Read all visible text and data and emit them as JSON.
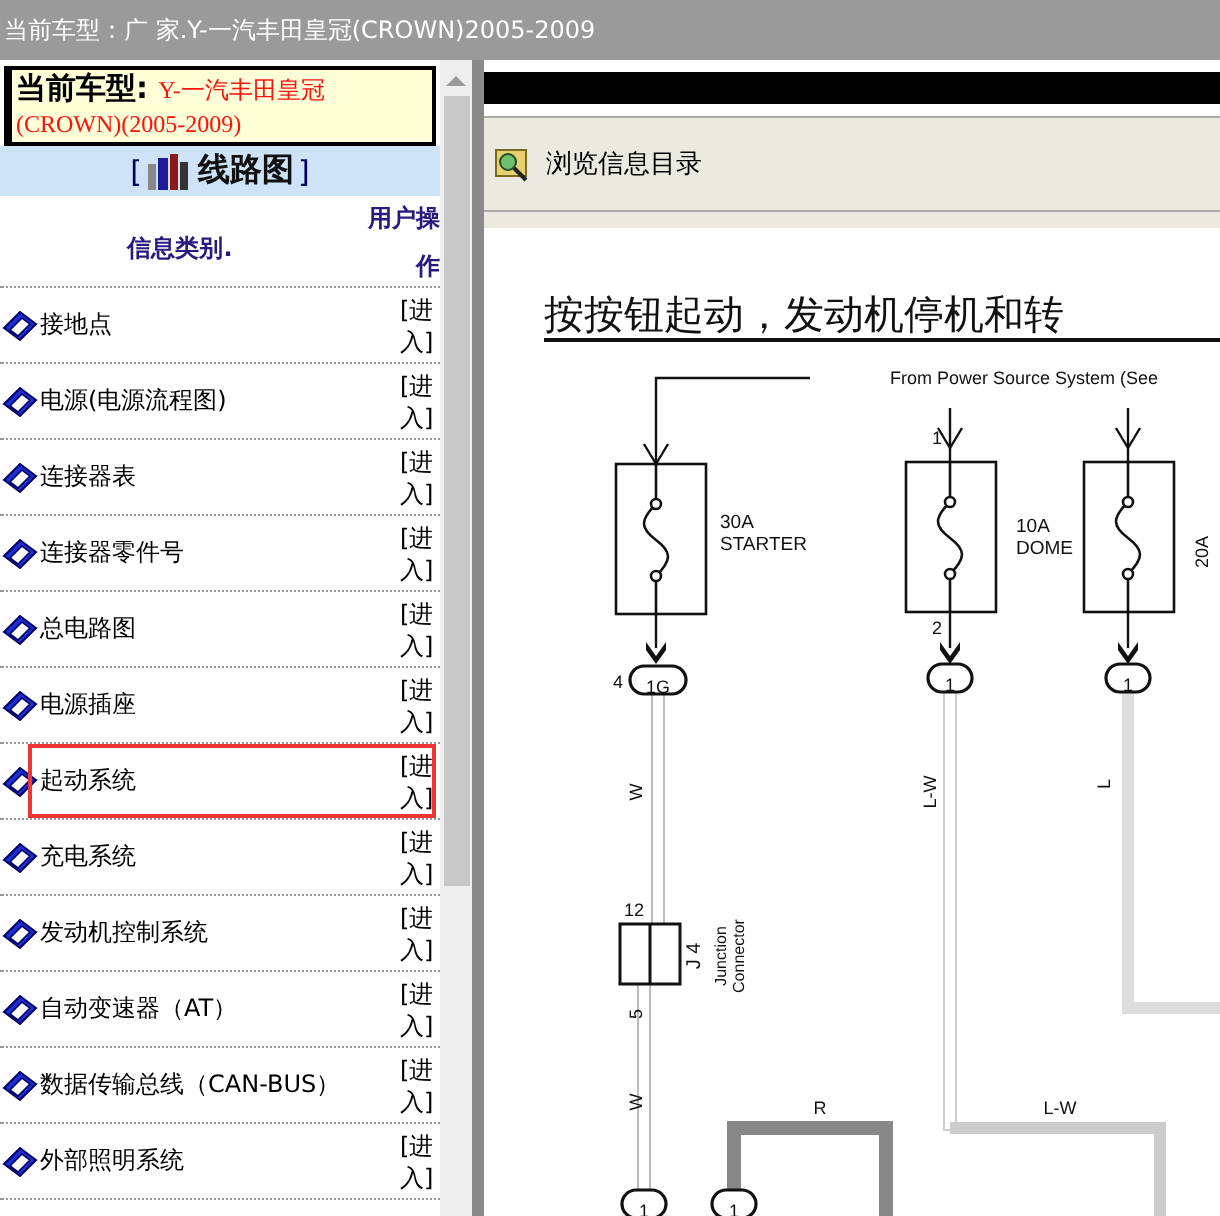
{
  "top_bar": {
    "text": "当前车型：广 家.Y-一汽丰田皇冠(CROWN)2005-2009"
  },
  "model_box": {
    "label": "当前车型:",
    "value": "Y-一汽丰田皇冠(CROWN)(2005-2009)"
  },
  "section": {
    "open_bracket": "[",
    "title": "线路图",
    "close_bracket": "]"
  },
  "columns": [
    "信息类别.",
    "用户操作"
  ],
  "rows": [
    {
      "name": "接地点",
      "action": "[进入]",
      "highlighted": false
    },
    {
      "name": "电源(电源流程图)",
      "action": "[进入]",
      "highlighted": false
    },
    {
      "name": "连接器表",
      "action": "[进入]",
      "highlighted": false
    },
    {
      "name": "连接器零件号",
      "action": "[进入]",
      "highlighted": false
    },
    {
      "name": "总电路图",
      "action": "[进入]",
      "highlighted": false
    },
    {
      "name": "电源插座",
      "action": "[进入]",
      "highlighted": false
    },
    {
      "name": "起动系统",
      "action": "[进入]",
      "highlighted": true
    },
    {
      "name": "充电系统",
      "action": "[进入]",
      "highlighted": false
    },
    {
      "name": "发动机控制系统",
      "action": "[进入]",
      "highlighted": false
    },
    {
      "name": "自动变速器（AT）",
      "action": "[进入]",
      "highlighted": false
    },
    {
      "name": "数据传输总线（CAN-BUS）",
      "action": "[进入]",
      "highlighted": false
    },
    {
      "name": "外部照明系统",
      "action": "[进入]",
      "highlighted": false
    }
  ],
  "viewer": {
    "toolbar_label": "浏览信息目录",
    "document": {
      "title": "按按钮起动，发动机停机和转",
      "labels": [
        "From Power Source System (See",
        "30A",
        "STARTER",
        "10A",
        "DOME",
        "1",
        "2",
        "20A",
        "4",
        "1G",
        "1",
        "1",
        "W",
        "L-W",
        "L",
        "12",
        "5",
        "J 4",
        "Junction",
        "Connector",
        "W",
        "R",
        "L-W",
        "1",
        "1"
      ]
    }
  }
}
